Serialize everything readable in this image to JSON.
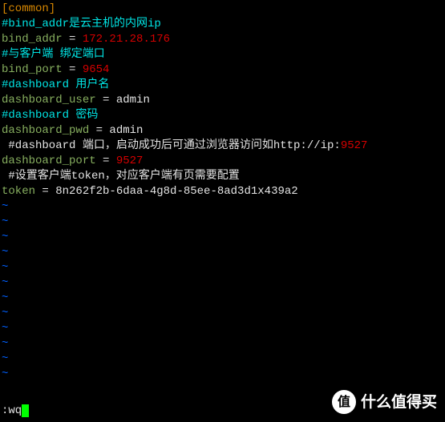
{
  "lines": [
    {
      "segments": [
        {
          "cls": "orange",
          "text": "[common]"
        }
      ]
    },
    {
      "segments": [
        {
          "cls": "cyan",
          "text": "#bind_addr是云主机的内网ip"
        }
      ]
    },
    {
      "segments": [
        {
          "cls": "green",
          "text": "bind_addr "
        },
        {
          "cls": "white",
          "text": "= "
        },
        {
          "cls": "red",
          "text": "172.21.28.176"
        }
      ]
    },
    {
      "segments": [
        {
          "cls": "cyan",
          "text": "#与客户端 绑定端口"
        }
      ]
    },
    {
      "segments": [
        {
          "cls": "green",
          "text": "bind_port "
        },
        {
          "cls": "white",
          "text": "= "
        },
        {
          "cls": "red",
          "text": "9654"
        }
      ]
    },
    {
      "segments": [
        {
          "cls": "cyan",
          "text": "#dashboard 用户名"
        }
      ]
    },
    {
      "segments": [
        {
          "cls": "green",
          "text": "dashboard_user "
        },
        {
          "cls": "white",
          "text": "= admin"
        }
      ]
    },
    {
      "segments": [
        {
          "cls": "cyan",
          "text": "#dashboard 密码"
        }
      ]
    },
    {
      "segments": [
        {
          "cls": "green",
          "text": "dashboard_pwd "
        },
        {
          "cls": "white",
          "text": "= admin"
        }
      ]
    },
    {
      "segments": [
        {
          "cls": "white",
          "text": " #dashboard 端口，启动成功后可通过浏览器访问如http://ip:"
        },
        {
          "cls": "red",
          "text": "9527"
        }
      ]
    },
    {
      "segments": [
        {
          "cls": "green",
          "text": "dashboard_port "
        },
        {
          "cls": "white",
          "text": "= "
        },
        {
          "cls": "red",
          "text": "9527"
        }
      ]
    },
    {
      "segments": [
        {
          "cls": "white",
          "text": " #设置客户端token，对应客户端有页需要配置"
        }
      ]
    },
    {
      "segments": [
        {
          "cls": "green",
          "text": "token "
        },
        {
          "cls": "white",
          "text": "= 8n262f2b-6daa-4g8d-85ee-8ad3d1x439a2"
        }
      ]
    },
    {
      "segments": [
        {
          "cls": "blue",
          "text": "~"
        }
      ]
    },
    {
      "segments": [
        {
          "cls": "blue",
          "text": "~"
        }
      ]
    },
    {
      "segments": [
        {
          "cls": "blue",
          "text": "~"
        }
      ]
    },
    {
      "segments": [
        {
          "cls": "blue",
          "text": "~"
        }
      ]
    },
    {
      "segments": [
        {
          "cls": "blue",
          "text": "~"
        }
      ]
    },
    {
      "segments": [
        {
          "cls": "blue",
          "text": "~"
        }
      ]
    },
    {
      "segments": [
        {
          "cls": "blue",
          "text": "~"
        }
      ]
    },
    {
      "segments": [
        {
          "cls": "blue",
          "text": "~"
        }
      ]
    },
    {
      "segments": [
        {
          "cls": "blue",
          "text": "~"
        }
      ]
    },
    {
      "segments": [
        {
          "cls": "blue",
          "text": "~"
        }
      ]
    },
    {
      "segments": [
        {
          "cls": "blue",
          "text": "~"
        }
      ]
    },
    {
      "segments": [
        {
          "cls": "blue",
          "text": "~"
        }
      ]
    }
  ],
  "cmd": ":wq",
  "watermark": {
    "icon": "值",
    "text": "什么值得买"
  }
}
